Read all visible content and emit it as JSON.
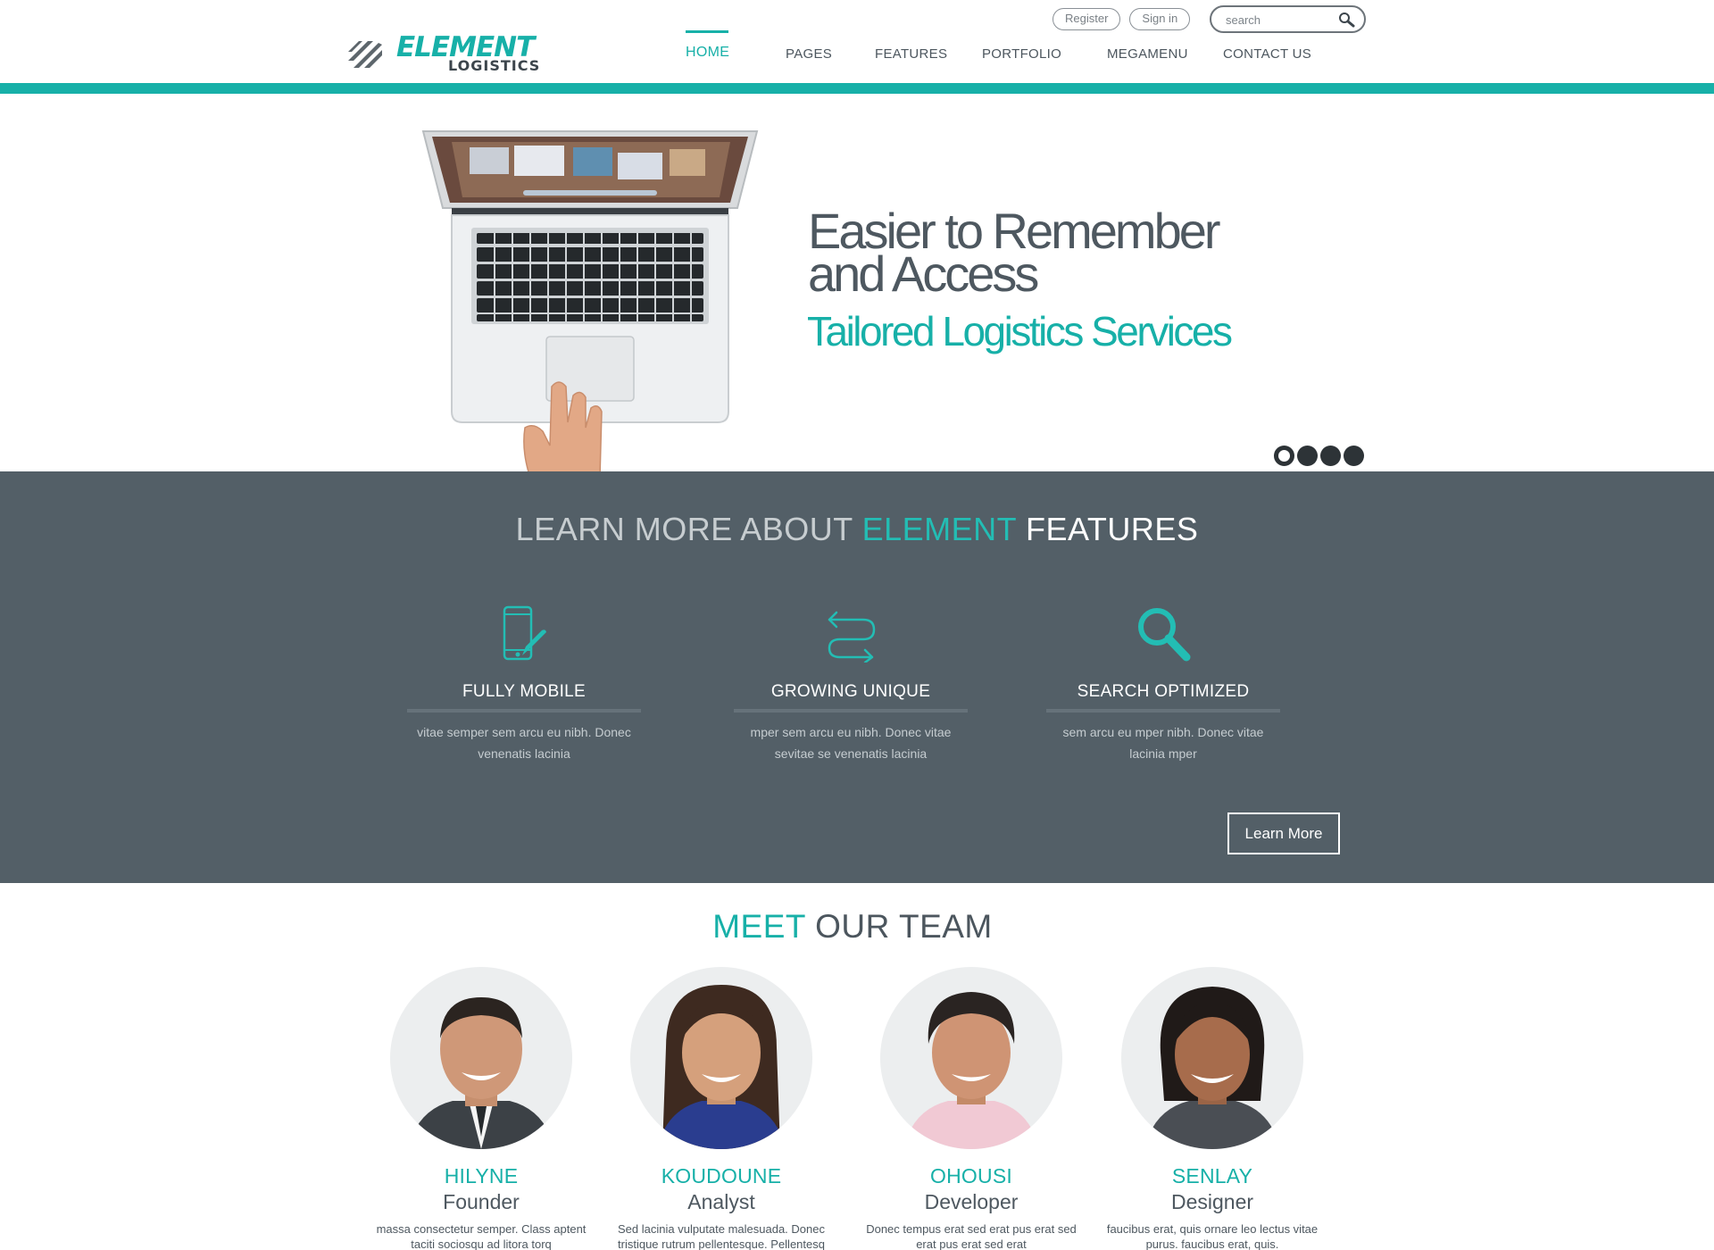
{
  "header": {
    "brand_main": "ELEMENT",
    "brand_sub": "LOGISTICS",
    "register_label": "Register",
    "signin_label": "Sign in",
    "search_placeholder": "search",
    "nav": [
      {
        "label": "HOME",
        "active": true
      },
      {
        "label": "PAGES",
        "active": false
      },
      {
        "label": "FEATURES",
        "active": false
      },
      {
        "label": "PORTFOLIO",
        "active": false
      },
      {
        "label": "MEGAMENU",
        "active": false
      },
      {
        "label": "CONTACT US",
        "active": false
      }
    ]
  },
  "hero": {
    "title_line1": "Easier to Remember",
    "title_line2": "and Access",
    "subtitle": "Tailored Logistics Services",
    "slides_count": 4,
    "active_slide": 1
  },
  "features": {
    "title_part1": "LEARN MORE ABOUT ",
    "title_part2": "ELEMENT",
    "title_part3": " FEATURES",
    "items": [
      {
        "icon": "mobile-edit-icon",
        "name": "FULLY MOBILE",
        "desc": "vitae semper sem arcu eu nibh. Donec venenatis lacinia"
      },
      {
        "icon": "arrows-swap-icon",
        "name": "GROWING UNIQUE",
        "desc": "mper sem arcu eu nibh. Donec vitae sevitae se venenatis lacinia"
      },
      {
        "icon": "search-icon",
        "name": "SEARCH OPTIMIZED",
        "desc": "sem arcu eu mper nibh. Donec vitae lacinia mper"
      }
    ],
    "button_label": "Learn More"
  },
  "team": {
    "title_part1": "MEET",
    "title_part2": " OUR TEAM",
    "members": [
      {
        "name": "HILYNE",
        "role": "Founder",
        "bio": "massa consectetur semper. Class aptent taciti sociosqu ad litora torq"
      },
      {
        "name": "KOUDOUNE",
        "role": "Analyst",
        "bio": "Sed lacinia vulputate malesuada. Donec tristique rutrum pellentesque. Pellentesq"
      },
      {
        "name": "OHOUSI",
        "role": "Developer",
        "bio": "Donec tempus erat sed erat pus erat sed erat pus erat sed erat"
      },
      {
        "name": "SENLAY",
        "role": "Designer",
        "bio": "faucibus erat, quis ornare leo lectus vitae purus. faucibus erat, quis."
      }
    ]
  },
  "colors": {
    "accent": "#17b0a8",
    "dark_band": "#535f67",
    "text": "#4e5860"
  }
}
